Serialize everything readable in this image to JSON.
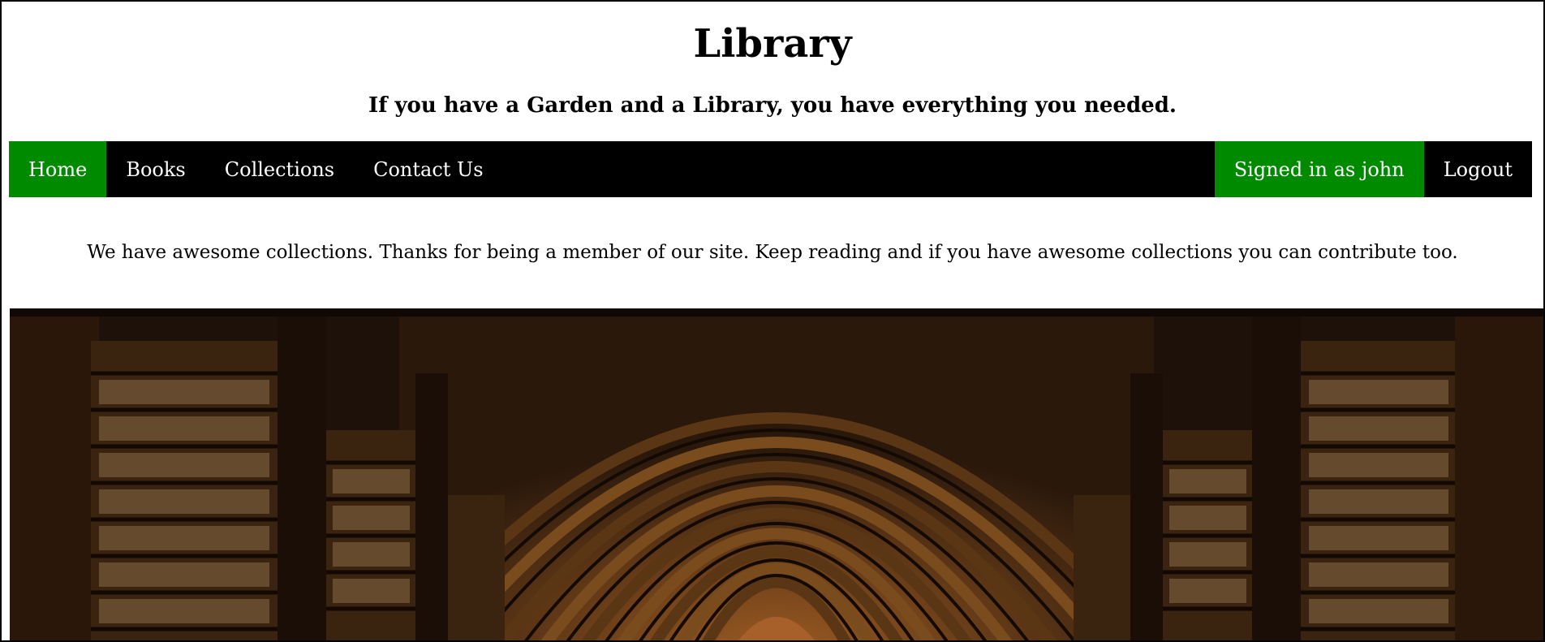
{
  "header": {
    "title": "Library",
    "tagline": "If you have a Garden and a Library, you have everything you needed."
  },
  "nav": {
    "left": [
      {
        "label": "Home",
        "active": true
      },
      {
        "label": "Books",
        "active": false
      },
      {
        "label": "Collections",
        "active": false
      },
      {
        "label": "Contact Us",
        "active": false
      }
    ],
    "right": [
      {
        "label": "Signed in as john",
        "active": true
      },
      {
        "label": "Logout",
        "active": false
      }
    ]
  },
  "main": {
    "intro": "We have awesome collections. Thanks for being a member of our site. Keep reading and if you have awesome collections you can contribute too."
  },
  "hero": {
    "image_icon": "library-hall-image"
  },
  "colors": {
    "nav_background": "#000000",
    "nav_active": "#008a00",
    "nav_text": "#ffffff",
    "page_background": "#ffffff"
  }
}
